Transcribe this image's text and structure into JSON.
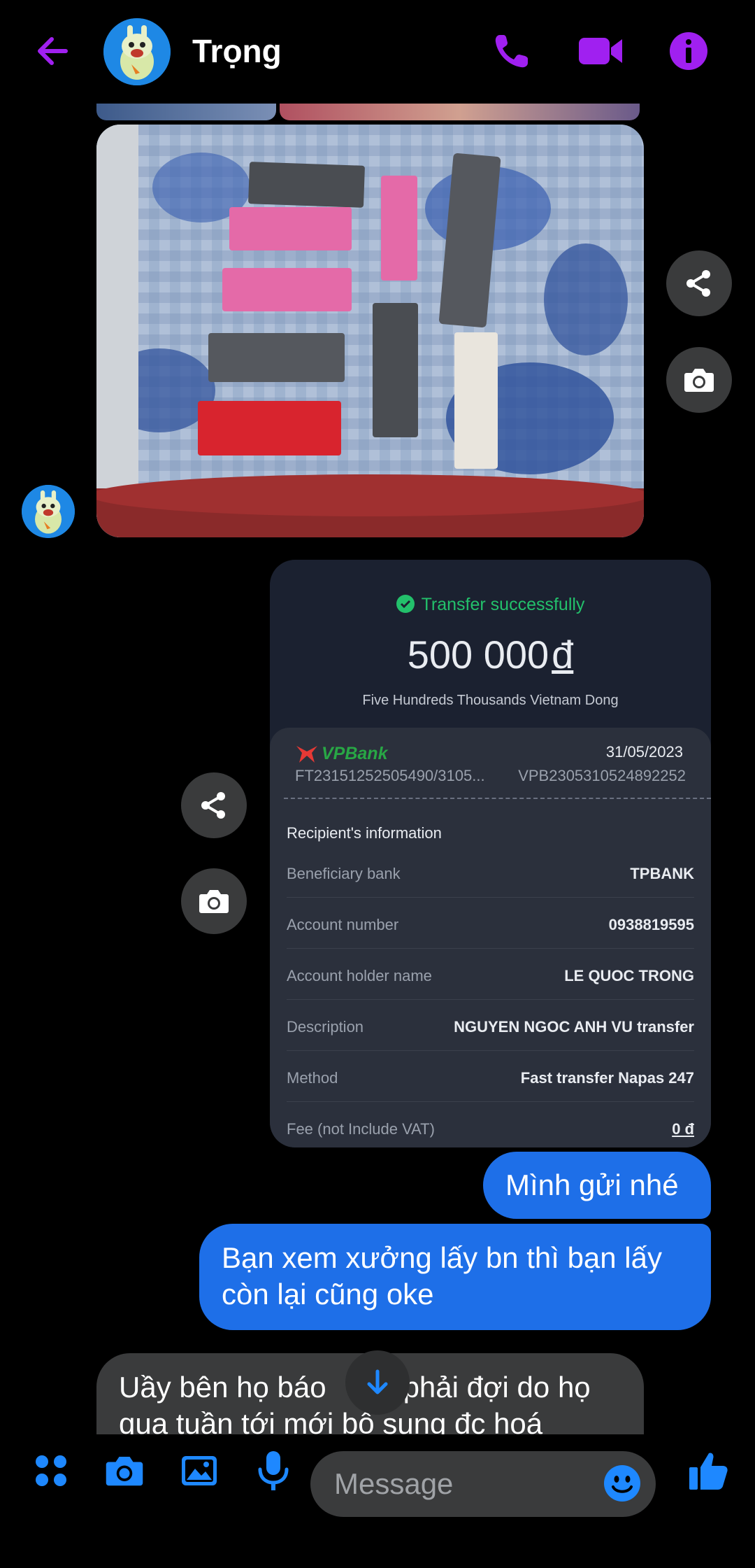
{
  "header": {
    "contact_name": "Trọng",
    "accent": "#a020f0"
  },
  "receipt": {
    "status": "Transfer successfully",
    "amount": "500 000",
    "currency": "đ",
    "amount_words": "Five Hundreds Thousands Vietnam Dong",
    "bank_logo": "VPBank",
    "date": "31/05/2023",
    "ref_left": "FT23151252505490/3105...",
    "ref_right": "VPB2305310524892252",
    "section_title": "Recipient's information",
    "rows": [
      {
        "label": "Beneficiary bank",
        "value": "TPBANK"
      },
      {
        "label": "Account number",
        "value": "0938819595"
      },
      {
        "label": "Account holder name",
        "value": "LE QUOC TRONG"
      },
      {
        "label": "Description",
        "value": "NGUYEN NGOC ANH VU transfer"
      },
      {
        "label": "Method",
        "value": "Fast transfer Napas 247"
      },
      {
        "label": "Fee (not Include VAT)",
        "value": "0 đ"
      }
    ]
  },
  "messages": {
    "out_1": "Mình gửi nhé",
    "out_2_line1": "Bạn xem xưởng lấy bn thì bạn lấy",
    "out_2_line2": "còn lại cũng oke",
    "in_1_line1": "Uầy bên họ báo",
    "in_1_line1b": "phải đợi do họ",
    "in_1_line2": "qua tuần tới mới bổ sung đc hoá"
  },
  "composer": {
    "placeholder": "Message"
  },
  "icons": {
    "back": "arrow-left-icon",
    "call": "phone-icon",
    "video": "video-camera-icon",
    "info": "info-icon",
    "share": "share-icon",
    "camera": "camera-icon",
    "scroll_down": "arrow-down-icon",
    "apps": "apps-grid-icon",
    "gallery": "gallery-icon",
    "mic": "microphone-icon",
    "emoji": "emoji-icon",
    "like": "thumbs-up-icon"
  }
}
